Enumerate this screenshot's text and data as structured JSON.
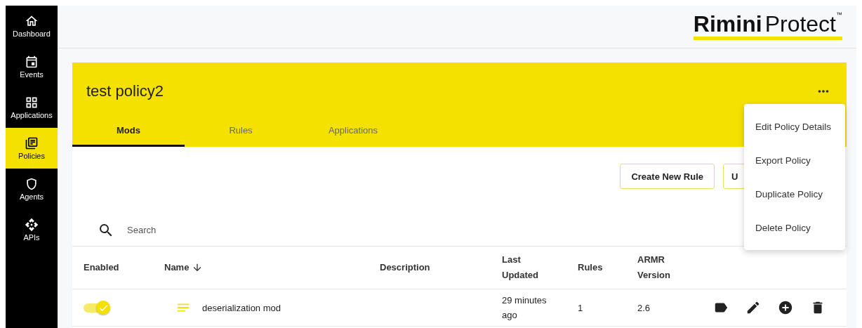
{
  "sidebar": {
    "items": [
      {
        "label": "Dashboard",
        "selected": false
      },
      {
        "label": "Events",
        "selected": false
      },
      {
        "label": "Applications",
        "selected": false
      },
      {
        "label": "Policies",
        "selected": true
      },
      {
        "label": "Agents",
        "selected": false
      },
      {
        "label": "APIs",
        "selected": false
      }
    ]
  },
  "header": {
    "logo": {
      "bold": "Rimini",
      "light": "Protect",
      "mark": "™"
    }
  },
  "policy": {
    "title": "test policy2",
    "tabs": [
      {
        "label": "Mods",
        "selected": true
      },
      {
        "label": "Rules",
        "selected": false
      },
      {
        "label": "Applications",
        "selected": false
      }
    ]
  },
  "buttons": [
    "Create New Rule",
    "U"
  ],
  "search": {
    "placeholder": "Search"
  },
  "table": {
    "columns": [
      {
        "label": "Enabled",
        "sorted": false
      },
      {
        "label": "Name",
        "sorted": true
      },
      {
        "label": "Description",
        "sorted": false
      },
      {
        "label": "Last Updated",
        "sorted": false
      },
      {
        "label": "Rules",
        "sorted": false
      },
      {
        "label": "ARMR Version",
        "sorted": false
      }
    ],
    "rows": [
      {
        "enabled": true,
        "name": "deserialization mod",
        "last_updated": "29 minutes ago",
        "rules": "1",
        "version": "2.6"
      }
    ]
  },
  "menu": {
    "items": [
      "Edit Policy Details",
      "Export Policy",
      "Duplicate Policy",
      "Delete Policy"
    ]
  }
}
